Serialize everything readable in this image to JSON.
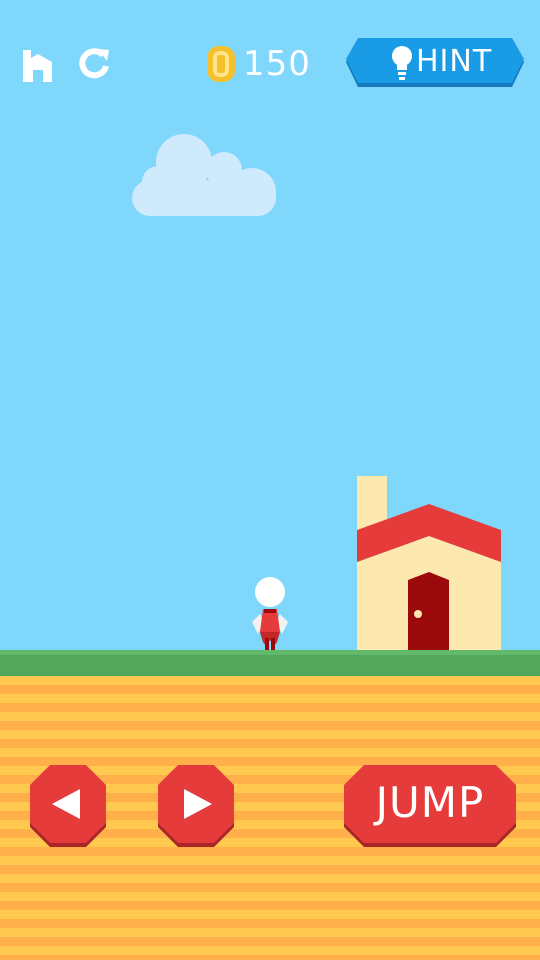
{
  "topbar": {
    "home_icon": "home-icon",
    "restart_icon": "restart-icon",
    "coin_icon": "coin-icon",
    "coin_count": "150",
    "hint_label": "HINT",
    "hint_icon": "lightbulb-icon"
  },
  "controls": {
    "left_icon": "arrow-left-icon",
    "right_icon": "arrow-right-icon",
    "jump_label": "JUMP"
  },
  "colors": {
    "sky": "#7fd7fb",
    "hint_blue": "#1a9be6",
    "control_red": "#e53b3b",
    "grass": "#53a75c",
    "dirt_light": "#ffc84e",
    "dirt_dark": "#ffb04a",
    "house_wall": "#fde8b0",
    "roof": "#e53b3b",
    "door": "#9b0a0a",
    "coin": "#f5c02c"
  }
}
